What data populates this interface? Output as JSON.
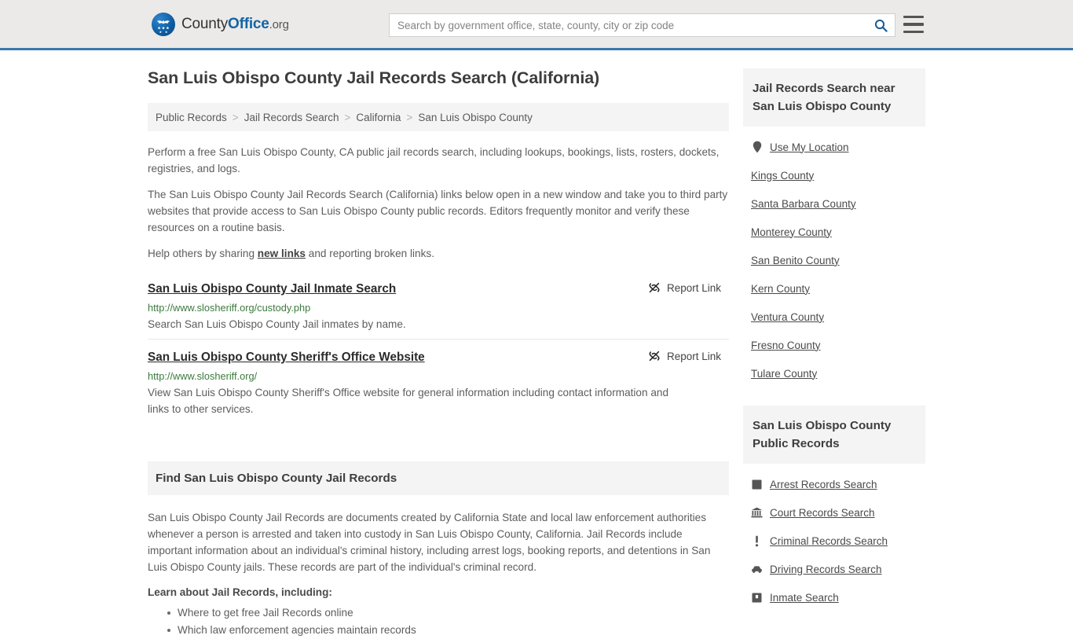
{
  "header": {
    "logo": {
      "icon": "eagle-shield-icon",
      "text_part1": "County",
      "text_part2": "Office",
      "text_part3": ".org"
    },
    "search": {
      "placeholder": "Search by government office, state, county, city or zip code",
      "value": "",
      "button_icon": "search-icon"
    },
    "menu_icon": "hamburger-menu-icon",
    "accent_color": "#3b77ab"
  },
  "main": {
    "title": "San Luis Obispo County Jail Records Search (California)",
    "breadcrumb": [
      "Public Records",
      "Jail Records Search",
      "California",
      "San Luis Obispo County"
    ],
    "breadcrumb_separator": ">",
    "intro_paragraph_1": "Perform a free San Luis Obispo County, CA public jail records search, including lookups, bookings, lists, rosters, dockets, registries, and logs.",
    "intro_paragraph_2": "The San Luis Obispo County Jail Records Search (California) links below open in a new window and take you to third party websites that provide access to San Luis Obispo County public records. Editors frequently monitor and verify these resources on a routine basis.",
    "help_prefix": "Help others by sharing ",
    "help_link": "new links",
    "help_suffix": " and reporting broken links.",
    "report_link_label": "Report Link",
    "report_link_icon": "broken-link-icon",
    "results": [
      {
        "title": "San Luis Obispo County Jail Inmate Search",
        "url": "http://www.slosheriff.org/custody.php",
        "description": "Search San Luis Obispo County Jail inmates by name."
      },
      {
        "title": "San Luis Obispo County Sheriff's Office Website",
        "url": "http://www.slosheriff.org/",
        "description": "View San Luis Obispo County Sheriff's Office website for general information including contact information and links to other services."
      }
    ],
    "find_section": {
      "heading": "Find San Luis Obispo County Jail Records",
      "paragraph": "San Luis Obispo County Jail Records are documents created by California State and local law enforcement authorities whenever a person is arrested and taken into custody in San Luis Obispo County, California. Jail Records include important information about an individual's criminal history, including arrest logs, booking reports, and detentions in San Luis Obispo County jails. These records are part of the individual's criminal record.",
      "learn_heading": "Learn about Jail Records, including:",
      "learn_items": [
        "Where to get free Jail Records online",
        "Which law enforcement agencies maintain records"
      ]
    }
  },
  "sidebar": {
    "nearby": {
      "heading": "Jail Records Search near San Luis Obispo County",
      "items": [
        {
          "label": "Use My Location",
          "icon": "map-pin-icon"
        },
        {
          "label": "Kings County",
          "icon": ""
        },
        {
          "label": "Santa Barbara County",
          "icon": ""
        },
        {
          "label": "Monterey County",
          "icon": ""
        },
        {
          "label": "San Benito County",
          "icon": ""
        },
        {
          "label": "Kern County",
          "icon": ""
        },
        {
          "label": "Ventura County",
          "icon": ""
        },
        {
          "label": "Fresno County",
          "icon": ""
        },
        {
          "label": "Tulare County",
          "icon": ""
        }
      ]
    },
    "public_records": {
      "heading": "San Luis Obispo County Public Records",
      "items": [
        {
          "label": "Arrest Records Search",
          "icon": "fingerprint-icon"
        },
        {
          "label": "Court Records Search",
          "icon": "courthouse-icon"
        },
        {
          "label": "Criminal Records Search",
          "icon": "exclamation-icon"
        },
        {
          "label": "Driving Records Search",
          "icon": "car-icon"
        },
        {
          "label": "Inmate Search",
          "icon": "jail-icon"
        }
      ]
    }
  }
}
